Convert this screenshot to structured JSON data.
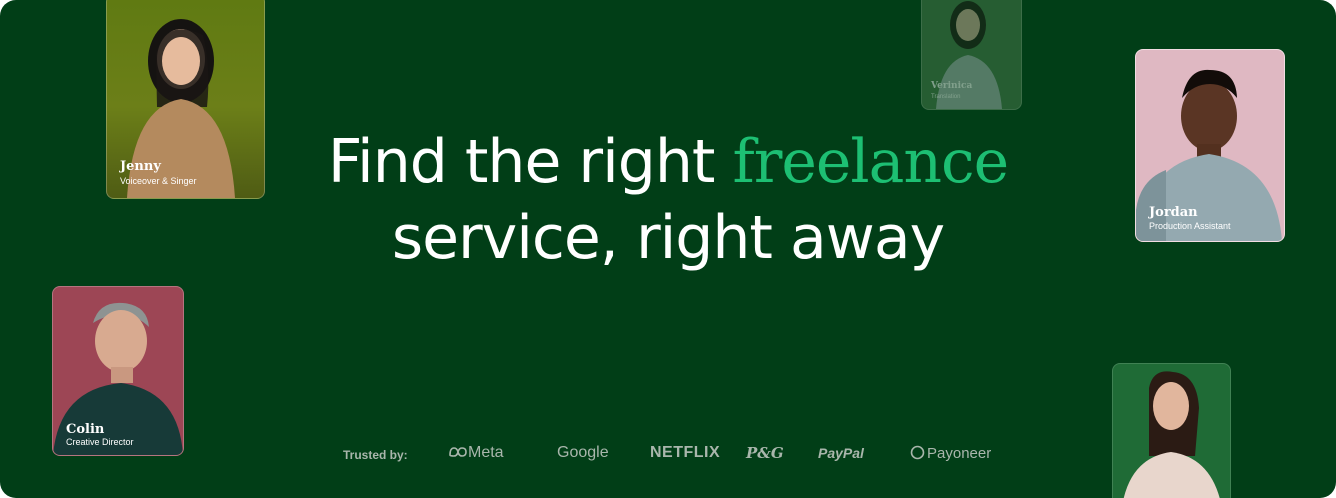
{
  "hero": {
    "headline_part1": "Find the right ",
    "headline_accent": "freelance",
    "headline_line2": "service, right away",
    "accent_color": "#1dbf73",
    "background_color": "#013e17"
  },
  "cards": [
    {
      "name": "Jenny",
      "role": "Voiceover & Singer"
    },
    {
      "name": "Verinica",
      "role": "Translation"
    },
    {
      "name": "Jordan",
      "role": "Production Assistant"
    },
    {
      "name": "Colin",
      "role": "Creative Director"
    }
  ],
  "trusted": {
    "label": "Trusted by:",
    "logos": [
      "Meta",
      "Google",
      "NETFLIX",
      "P&G",
      "PayPal",
      "Payoneer"
    ]
  },
  "icons": {
    "meta": "meta-infinity-icon",
    "payoneer": "payoneer-ring-icon"
  }
}
